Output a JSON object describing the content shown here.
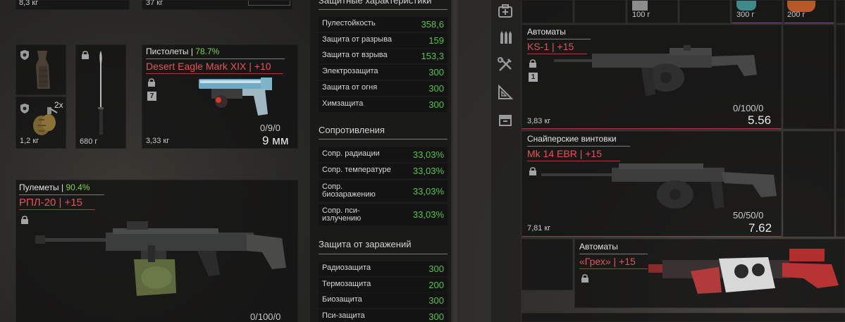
{
  "left": {
    "top_weights": [
      "8,3 кг",
      "37 кг"
    ],
    "small_items": {
      "grip_weight": "1,2 кг",
      "grenade_count": "2x",
      "knife_weight": "680 г"
    },
    "pistol": {
      "category": "Пистолеты",
      "percent": "78.7%",
      "name": "Desert Eagle Mark XIX",
      "upgrade": "+10",
      "badge": "7",
      "ammo": "0/9/0",
      "caliber": "9 мм",
      "weight": "3,33 кг"
    },
    "mg": {
      "category": "Пулеметы",
      "percent": "90.4%",
      "name": "РПЛ-20",
      "upgrade": "+15",
      "ammo": "0/100/0"
    }
  },
  "stats": {
    "protection_title": "Защитные характеристики",
    "protection": [
      {
        "label": "Пулестойкость",
        "value": "358,6"
      },
      {
        "label": "Защита от разрыва",
        "value": "159"
      },
      {
        "label": "Защита от взрыва",
        "value": "153,3"
      },
      {
        "label": "Электрозащита",
        "value": "300"
      },
      {
        "label": "Защита от огня",
        "value": "300"
      },
      {
        "label": "Химзащита",
        "value": "300"
      }
    ],
    "resist_title": "Сопротивления",
    "resist": [
      {
        "label": "Сопр. радиации",
        "value": "33,03%"
      },
      {
        "label": "Сопр. температуре",
        "value": "33,03%"
      },
      {
        "label": "Сопр. биозаражению",
        "value": "33,03%"
      },
      {
        "label": "Сопр. пси-излучению",
        "value": "33,03%"
      }
    ],
    "infection_title": "Защита от заражений",
    "infection": [
      {
        "label": "Радиозащита",
        "value": "300"
      },
      {
        "label": "Термозащита",
        "value": "200"
      },
      {
        "label": "Биозащита",
        "value": "300"
      },
      {
        "label": "Пси-защита",
        "value": "300"
      }
    ]
  },
  "right": {
    "top_weights": [
      "100 г",
      "300 г",
      "200 г"
    ],
    "ks1": {
      "category": "Автоматы",
      "name": "KS-1",
      "upgrade": "+15",
      "badge": "1",
      "ammo": "0/100/0",
      "stat": "5.56",
      "weight": "3,83 кг"
    },
    "mk14": {
      "category": "Снайперские винтовки",
      "name": "Mk 14 EBR",
      "upgrade": "+15",
      "ammo": "50/50/0",
      "stat": "7.62",
      "weight": "7,81 кг"
    },
    "grekh": {
      "category": "Автоматы",
      "name": "«Грех»",
      "upgrade": "+15"
    }
  },
  "colors": {
    "accent_red": "#e2545a",
    "stat_green": "#57c44a",
    "percent_green": "#7fd14f"
  }
}
